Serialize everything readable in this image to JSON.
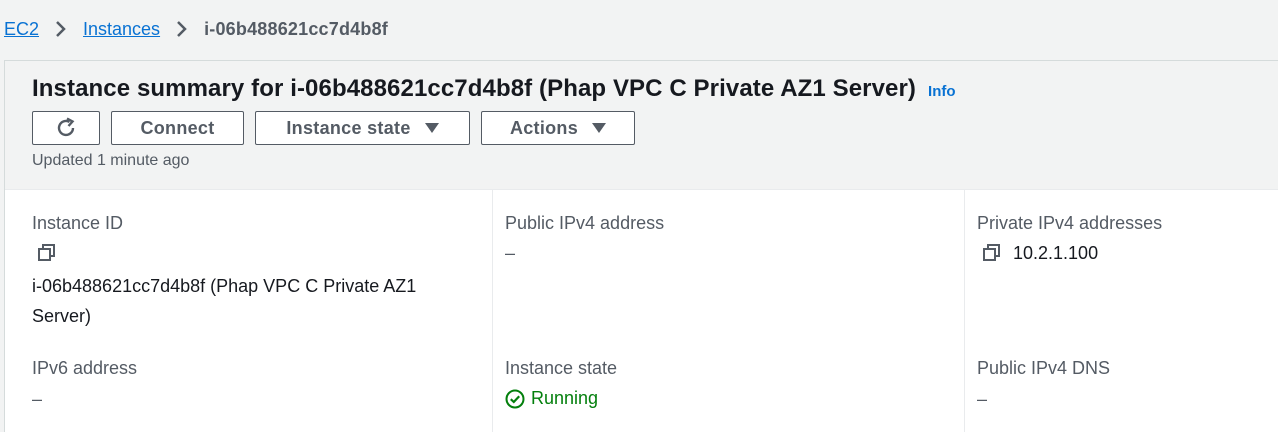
{
  "breadcrumb": {
    "items": [
      "EC2",
      "Instances"
    ],
    "current": "i-06b488621cc7d4b8f"
  },
  "header": {
    "title": "Instance summary for i-06b488621cc7d4b8f (Phap VPC C Private AZ1 Server)",
    "info_label": "Info",
    "updated_text": "Updated 1 minute ago"
  },
  "buttons": {
    "connect": "Connect",
    "instance_state": "Instance state",
    "actions": "Actions"
  },
  "details": {
    "instance_id": {
      "label": "Instance ID",
      "value_line1": "i-06b488621cc7d4b8f (Phap VPC C Private AZ1",
      "value_line2": "Server)"
    },
    "public_ipv4": {
      "label": "Public IPv4 address",
      "value": "–"
    },
    "private_ipv4": {
      "label": "Private IPv4 addresses",
      "value": "10.2.1.100"
    },
    "ipv6": {
      "label": "IPv6 address",
      "value": "–"
    },
    "instance_state": {
      "label": "Instance state",
      "value": "Running"
    },
    "public_dns": {
      "label": "Public IPv4 DNS",
      "value": "–"
    }
  },
  "icons": {
    "refresh": "refresh-icon",
    "caret": "caret-down-icon",
    "copy": "copy-icon",
    "status_ok": "status-success-icon",
    "breadcrumb_separator": "chevron-right-icon"
  },
  "colors": {
    "link": "#0972d3",
    "success": "#037f0c",
    "text": "#16191f",
    "muted": "#545b64"
  }
}
